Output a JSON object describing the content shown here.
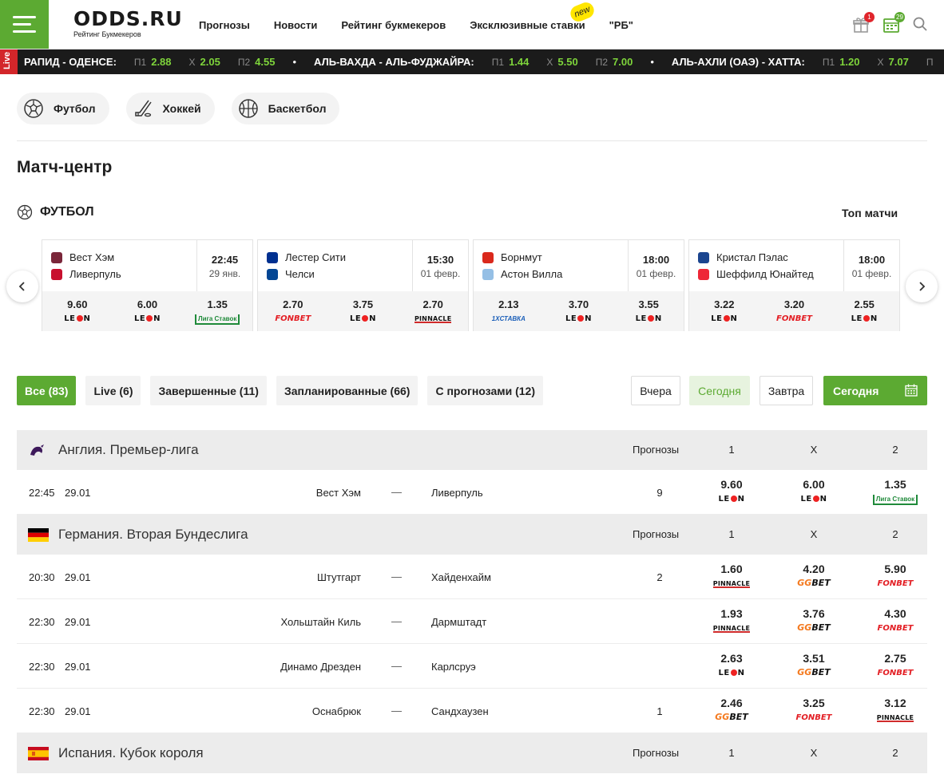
{
  "header": {
    "logo": "ODDS.RU",
    "logo_sub": "Рейтинг Букмекеров",
    "nav": [
      {
        "label": "Прогнозы"
      },
      {
        "label": "Новости"
      },
      {
        "label": "Рейтинг букмекеров"
      },
      {
        "label": "Эксклюзивные ставки",
        "badge": "new"
      },
      {
        "label": "\"РБ\""
      }
    ],
    "gift_badge": "1",
    "calendar_badge": "29",
    "colors": {
      "brand": "#5caa32",
      "badge_red": "#e0262c"
    }
  },
  "ticker": {
    "live_label": "Live",
    "matches": [
      {
        "name": "РАПИД - ОДЕНСЕ:",
        "odds": [
          {
            "label": "П1",
            "value": "2.88"
          },
          {
            "label": "Х",
            "value": "2.05"
          },
          {
            "label": "П2",
            "value": "4.55"
          }
        ]
      },
      {
        "name": "АЛЬ-ВАХДА - АЛЬ-ФУДЖАЙРА:",
        "odds": [
          {
            "label": "П1",
            "value": "1.44"
          },
          {
            "label": "Х",
            "value": "5.50"
          },
          {
            "label": "П2",
            "value": "7.00"
          }
        ]
      },
      {
        "name": "АЛЬ-АХЛИ (ОАЭ) - ХАТТА:",
        "odds": [
          {
            "label": "П1",
            "value": "1.20"
          },
          {
            "label": "Х",
            "value": "7.07"
          },
          {
            "label": "П",
            "value": ""
          }
        ]
      }
    ]
  },
  "sports": [
    {
      "label": "Футбол",
      "icon": "soccer-ball-icon"
    },
    {
      "label": "Хоккей",
      "icon": "hockey-stick-icon"
    },
    {
      "label": "Баскетбол",
      "icon": "basketball-icon"
    }
  ],
  "page_title": "Матч-центр",
  "section": {
    "title": "ФУТБОЛ",
    "top_link": "Топ матчи"
  },
  "cards": [
    {
      "home": "Вест Хэм",
      "away": "Ливерпуль",
      "time": "22:45",
      "date": "29 янв.",
      "home_color": "#7a263a",
      "away_color": "#c8102e",
      "odds": [
        {
          "value": "9.60",
          "bk": "leon"
        },
        {
          "value": "6.00",
          "bk": "leon"
        },
        {
          "value": "1.35",
          "bk": "liga"
        }
      ]
    },
    {
      "home": "Лестер Сити",
      "away": "Челси",
      "time": "15:30",
      "date": "01 февр.",
      "home_color": "#003090",
      "away_color": "#034694",
      "odds": [
        {
          "value": "2.70",
          "bk": "fonbet"
        },
        {
          "value": "3.75",
          "bk": "leon"
        },
        {
          "value": "2.70",
          "bk": "pinnacle"
        }
      ]
    },
    {
      "home": "Борнмут",
      "away": "Астон Вилла",
      "time": "18:00",
      "date": "01 февр.",
      "home_color": "#da291c",
      "away_color": "#95bfe5",
      "odds": [
        {
          "value": "2.13",
          "bk": "1xstavka"
        },
        {
          "value": "3.70",
          "bk": "leon"
        },
        {
          "value": "3.55",
          "bk": "leon"
        }
      ]
    },
    {
      "home": "Кристал Пэлас",
      "away": "Шеффилд Юнайтед",
      "time": "18:00",
      "date": "01 февр.",
      "home_color": "#1b458f",
      "away_color": "#ee2737",
      "odds": [
        {
          "value": "3.22",
          "bk": "leon"
        },
        {
          "value": "3.20",
          "bk": "fonbet"
        },
        {
          "value": "2.55",
          "bk": "leon"
        }
      ]
    }
  ],
  "bookmakers": {
    "leon_a": "LE",
    "leon_b": "N",
    "fonbet": "FONBET",
    "pinnacle": "PINNACLE",
    "liga": "Лига Ставок",
    "gg_a": "GG",
    "gg_b": "BET",
    "xstavka": "1XСТАВКА"
  },
  "filters": [
    {
      "label": "Все (83)",
      "active": true
    },
    {
      "label": "Live (6)"
    },
    {
      "label": "Завершенные (11)"
    },
    {
      "label": "Запланированные (66)"
    },
    {
      "label": "С прогнозами (12)"
    }
  ],
  "days": {
    "yesterday": "Вчера",
    "today": "Сегодня",
    "tomorrow": "Завтра",
    "picker": "Сегодня"
  },
  "table": {
    "col_prognoses": "Прогнозы",
    "col_1": "1",
    "col_x": "X",
    "col_2": "2",
    "leagues": [
      {
        "name": "Англия. Премьер-лига",
        "flag": "premier-league-icon",
        "matches": [
          {
            "time": "22:45",
            "date": "29.01",
            "home": "Вест Хэм",
            "away": "Ливерпуль",
            "count": "9",
            "odds": [
              {
                "value": "9.60",
                "bk": "leon"
              },
              {
                "value": "6.00",
                "bk": "leon"
              },
              {
                "value": "1.35",
                "bk": "liga"
              }
            ]
          }
        ]
      },
      {
        "name": "Германия. Вторая Бундеслига",
        "flag": "germany-flag-icon",
        "matches": [
          {
            "time": "20:30",
            "date": "29.01",
            "home": "Штутгарт",
            "away": "Хайденхайм",
            "count": "2",
            "odds": [
              {
                "value": "1.60",
                "bk": "pinnacle"
              },
              {
                "value": "4.20",
                "bk": "ggbet"
              },
              {
                "value": "5.90",
                "bk": "fonbet"
              }
            ]
          },
          {
            "time": "22:30",
            "date": "29.01",
            "home": "Хольштайн Киль",
            "away": "Дармштадт",
            "count": "",
            "odds": [
              {
                "value": "1.93",
                "bk": "pinnacle"
              },
              {
                "value": "3.76",
                "bk": "ggbet"
              },
              {
                "value": "4.30",
                "bk": "fonbet"
              }
            ]
          },
          {
            "time": "22:30",
            "date": "29.01",
            "home": "Динамо Дрезден",
            "away": "Карлсруэ",
            "count": "",
            "odds": [
              {
                "value": "2.63",
                "bk": "leon"
              },
              {
                "value": "3.51",
                "bk": "ggbet"
              },
              {
                "value": "2.75",
                "bk": "fonbet"
              }
            ]
          },
          {
            "time": "22:30",
            "date": "29.01",
            "home": "Оснабрюк",
            "away": "Сандхаузен",
            "count": "1",
            "odds": [
              {
                "value": "2.46",
                "bk": "ggbet"
              },
              {
                "value": "3.25",
                "bk": "fonbet"
              },
              {
                "value": "3.12",
                "bk": "pinnacle"
              }
            ]
          }
        ]
      },
      {
        "name": "Испания. Кубок короля",
        "flag": "spain-flag-icon",
        "matches": []
      }
    ]
  },
  "match_dash": "—"
}
